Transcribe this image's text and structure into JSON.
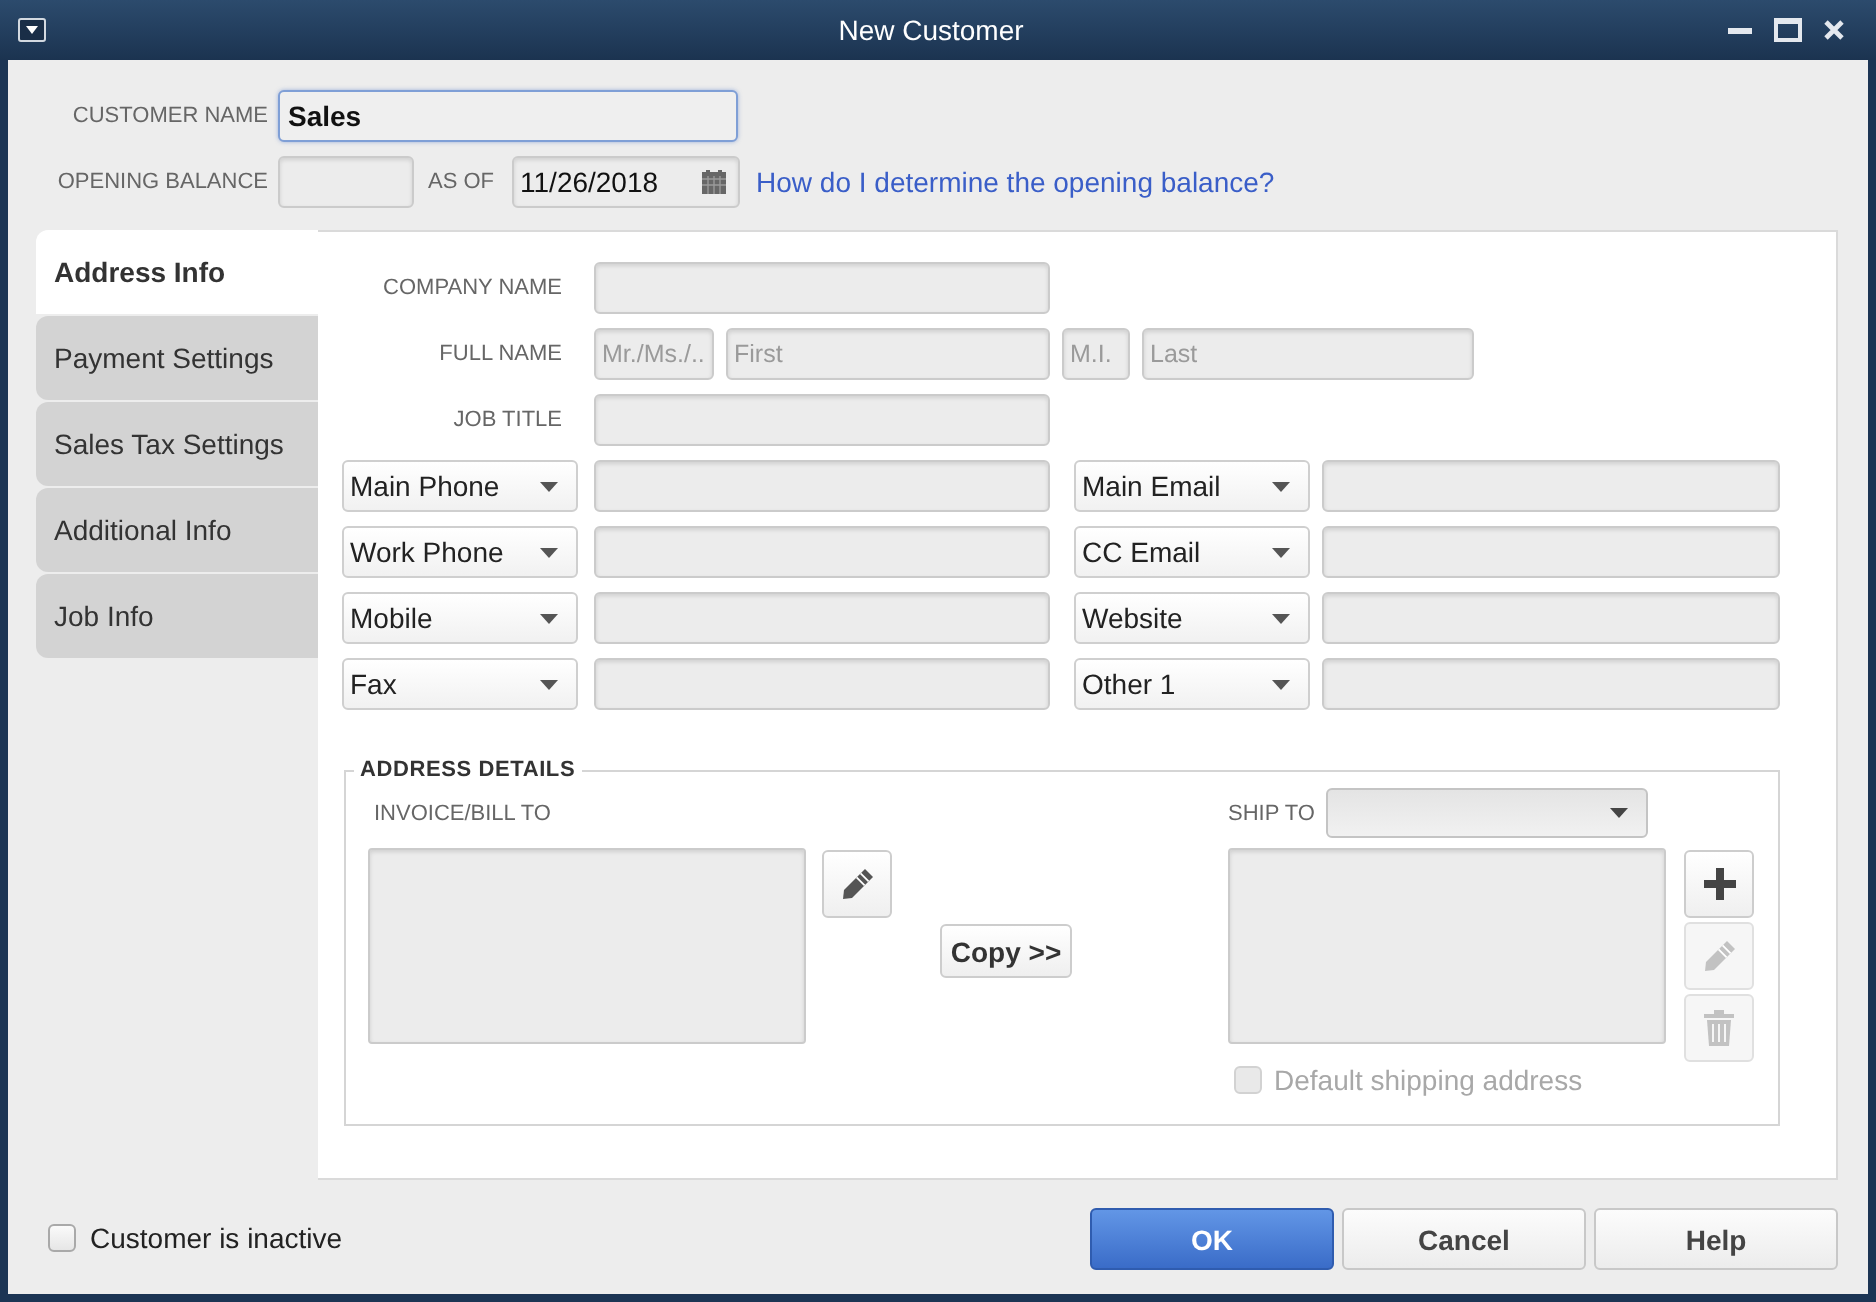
{
  "window": {
    "title": "New Customer"
  },
  "customer_name": {
    "label": "CUSTOMER NAME",
    "value": "Sales",
    "focused": true
  },
  "opening_balance": {
    "label": "OPENING BALANCE",
    "as_of_label": "AS OF",
    "date": "11/26/2018",
    "help_link": "How do I determine the opening balance?"
  },
  "tabs": [
    {
      "label": "Address Info",
      "selected": true
    },
    {
      "label": "Payment Settings",
      "selected": false
    },
    {
      "label": "Sales Tax Settings",
      "selected": false
    },
    {
      "label": "Additional Info",
      "selected": false
    },
    {
      "label": "Job Info",
      "selected": false
    }
  ],
  "address_info": {
    "company_name": {
      "label": "COMPANY NAME"
    },
    "full_name": {
      "label": "FULL NAME",
      "fields": [
        {
          "placeholder": "Mr./Ms./.."
        },
        {
          "placeholder": "First"
        },
        {
          "placeholder": "M.I."
        },
        {
          "placeholder": "Last"
        }
      ]
    },
    "job_title": {
      "label": "JOB TITLE"
    },
    "contact_rows": [
      [
        "Main Phone",
        "Main Email"
      ],
      [
        "Work Phone",
        "CC Email"
      ],
      [
        "Mobile",
        "Website"
      ],
      [
        "Fax",
        "Other 1"
      ]
    ],
    "address_details": {
      "title": "ADDRESS DETAILS",
      "bill_to_label": "INVOICE/BILL TO",
      "copy_button": "Copy >>",
      "ship_to_label": "SHIP TO",
      "ship_actions": [
        {
          "kind": "add",
          "disabled": false
        },
        {
          "kind": "edit",
          "disabled": true
        },
        {
          "kind": "delete",
          "disabled": true
        }
      ],
      "default_shipping": {
        "label": "Default shipping address",
        "checked": false,
        "disabled": true
      }
    }
  },
  "inactive": {
    "label": "Customer is inactive",
    "checked": false
  },
  "buttons": [
    {
      "label": "OK",
      "primary": true
    },
    {
      "label": "Cancel",
      "primary": false
    },
    {
      "label": "Help",
      "primary": false
    }
  ]
}
